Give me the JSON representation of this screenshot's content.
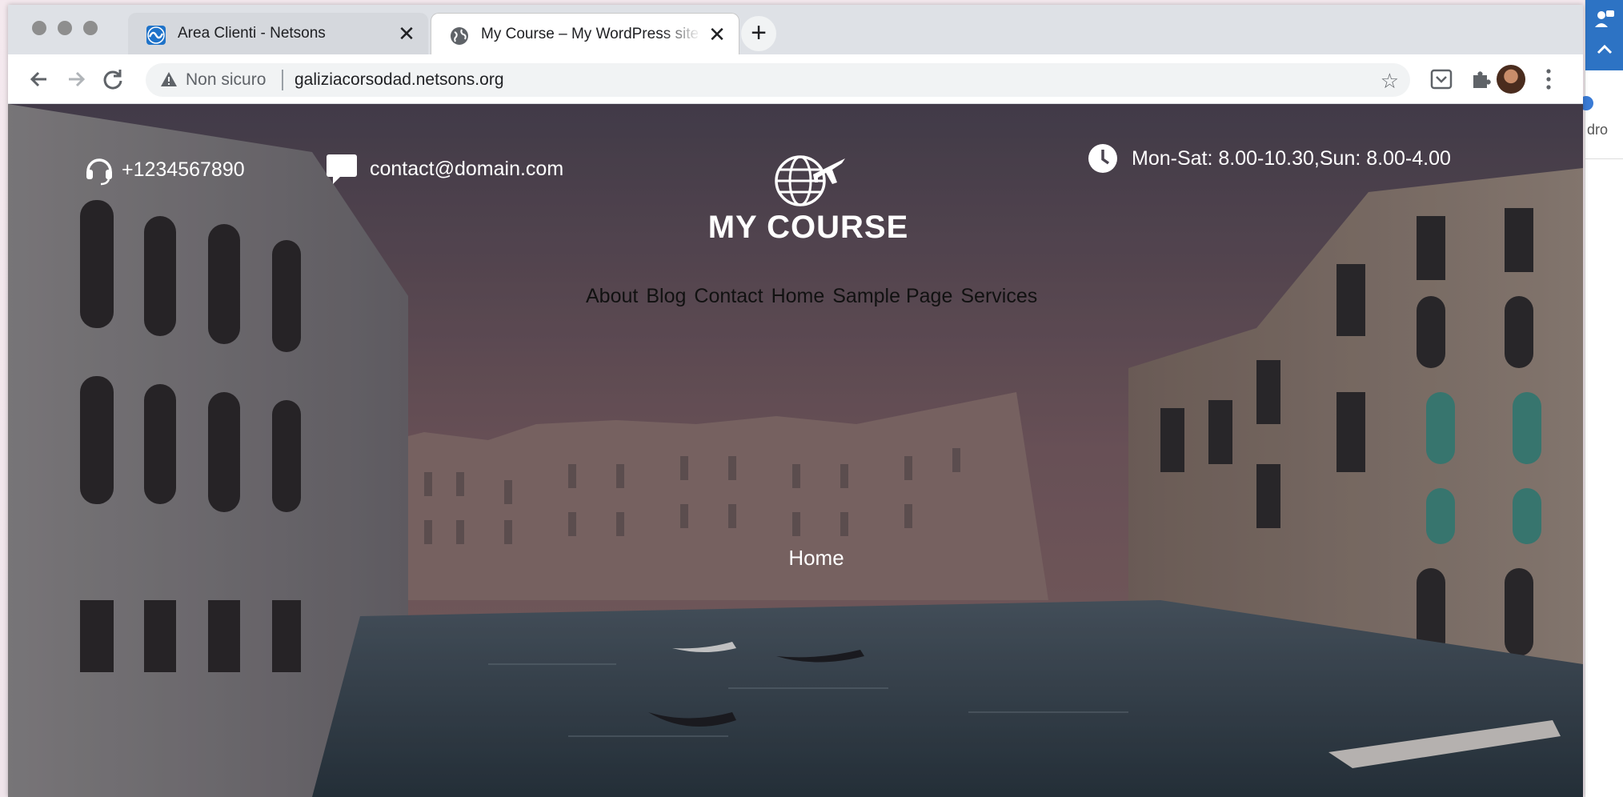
{
  "browser": {
    "tabs": [
      {
        "title": "Area Clienti - Netsons",
        "active": false,
        "icon": "netsons-favicon"
      },
      {
        "title": "My Course – My WordPress site",
        "active": true,
        "icon": "globe-favicon"
      }
    ],
    "close_glyph": "✕",
    "new_tab_glyph": "+",
    "security_label": "Non sicuro",
    "url": "galiziacorsodad.netsons.org",
    "star_glyph": "☆"
  },
  "site": {
    "phone": "+1234567890",
    "email": "contact@domain.com",
    "hours": "Mon-Sat: 8.00-10.30,Sun: 8.00-4.00",
    "logo_text": "MY COURSE",
    "nav": [
      "About",
      "Blog",
      "Contact",
      "Home",
      "Sample Page",
      "Services"
    ],
    "hero_title": "Home"
  },
  "side_app": {
    "partial_text": "dro"
  },
  "colors": {
    "chrome_tabstrip": "#dee1e6",
    "active_tab": "#ffffff",
    "omnibox": "#f1f3f4",
    "side_app_blue": "#2d73c4"
  }
}
